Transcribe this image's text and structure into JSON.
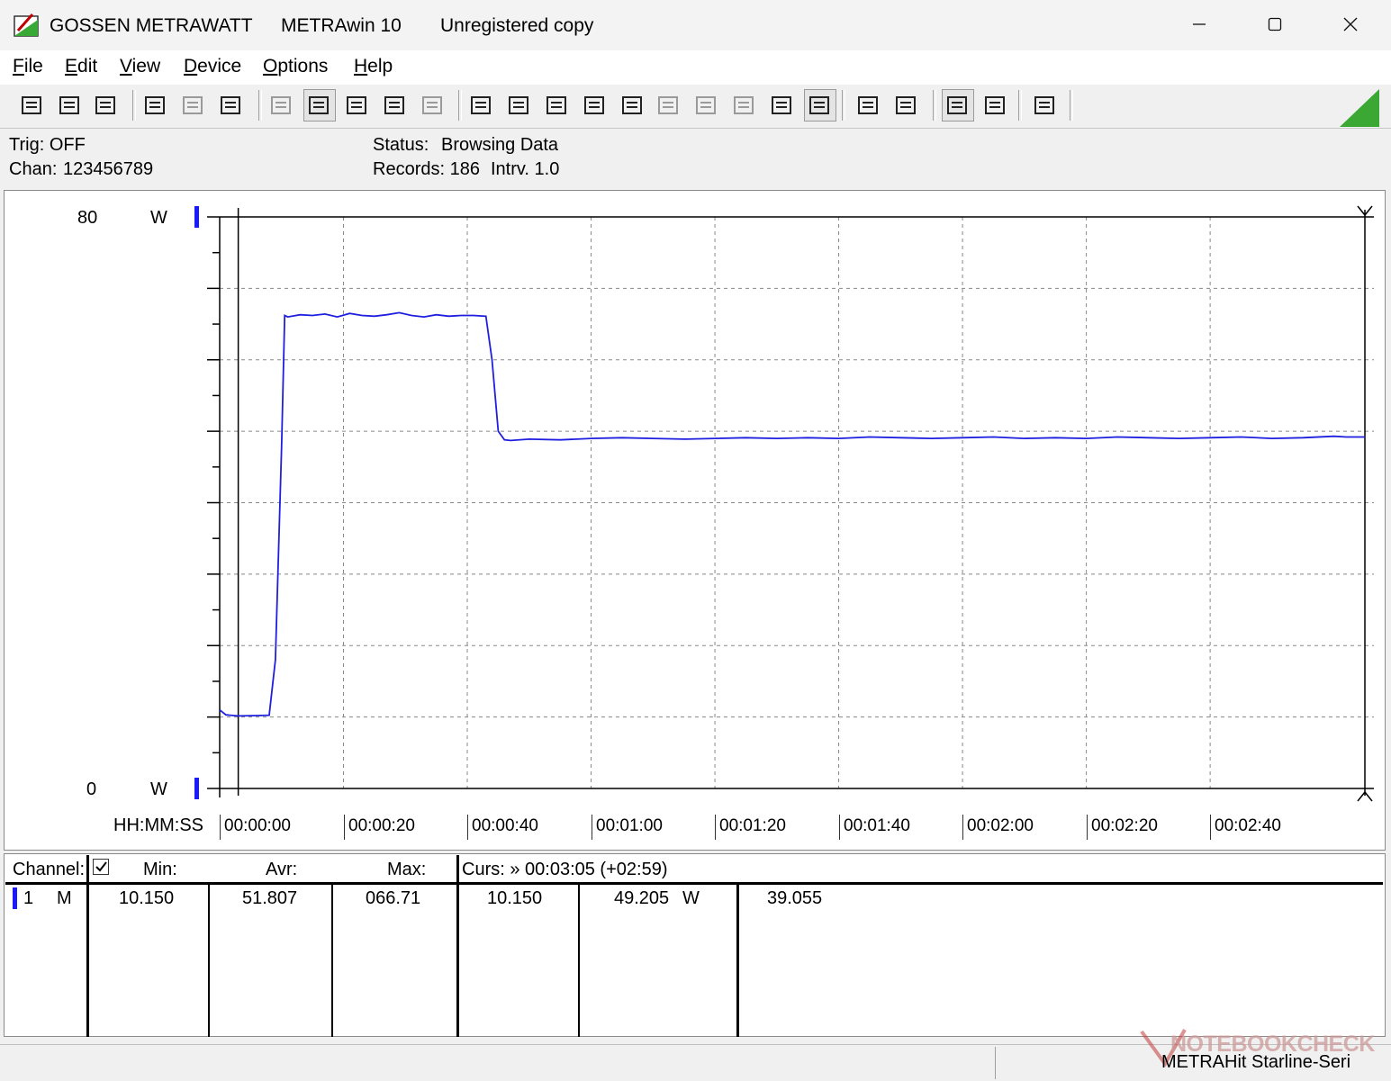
{
  "window": {
    "brand": "GOSSEN METRAWATT",
    "app": "METRAwin 10",
    "registration": "Unregistered copy",
    "minimize_glyph": "—",
    "maximize_glyph": "☐",
    "close_glyph": "✕"
  },
  "menu": [
    {
      "first": "F",
      "rest": "ile"
    },
    {
      "first": "E",
      "rest": "dit"
    },
    {
      "first": "V",
      "rest": "iew"
    },
    {
      "first": "D",
      "rest": "evice"
    },
    {
      "first": "O",
      "rest": "ptions"
    },
    {
      "first": "H",
      "rest": "elp"
    }
  ],
  "toolbar_icons": [
    "save-icon",
    "save-as-icon",
    "open-icon",
    "start-recording-icon",
    "stop-recording-icon",
    "read-memory-icon",
    "numeric-display-icon",
    "line-chart-icon",
    "cursor-crosshair-icon",
    "table-view-icon",
    "bar-chart-icon",
    "align-icon",
    "zoom-fit-icon",
    "list-view-icon",
    "monitor-icon",
    "function-icon",
    "device-icon",
    "waveform-icon",
    "signal-icon",
    "clock-settings-icon",
    "timer-icon",
    "print-icon",
    "print-preview-icon",
    "zoom-icon",
    "zoom-out-icon",
    "comment-icon"
  ],
  "status": {
    "trig": "Trig: OFF",
    "chan_label": "Chan:",
    "chan_value": "123456789",
    "status_label": "Status:",
    "status_value": "Browsing Data",
    "records": "Records: 186",
    "interval": "Intrv. 1.0"
  },
  "chart_data": {
    "type": "line",
    "y_unit": "W",
    "ylim": [
      0,
      80
    ],
    "y_top_label": "80",
    "y_bottom_label": "0",
    "x_axis_label": "HH:MM:SS",
    "xlim_seconds": [
      0,
      185
    ],
    "x_tick_labels": [
      "00:00:00",
      "00:00:20",
      "00:00:40",
      "00:01:00",
      "00:01:20",
      "00:01:40",
      "00:02:00",
      "00:02:20",
      "00:02:40"
    ],
    "x_tick_seconds": [
      0,
      20,
      40,
      60,
      80,
      100,
      120,
      140,
      160
    ],
    "grid": true,
    "line_color": "#1f1fe0",
    "series": [
      {
        "x": [
          0,
          1,
          3,
          6,
          8,
          9,
          10,
          10.5,
          11,
          13,
          15,
          17,
          19,
          21,
          23,
          25,
          27,
          29,
          31,
          33,
          35,
          37,
          39,
          41,
          43,
          44,
          45,
          46,
          47,
          50,
          55,
          60,
          65,
          70,
          75,
          80,
          85,
          90,
          95,
          100,
          105,
          110,
          115,
          120,
          125,
          130,
          135,
          140,
          145,
          150,
          155,
          160,
          165,
          170,
          175,
          180,
          182,
          185
        ],
        "y": [
          11.0,
          10.3,
          10.15,
          10.2,
          10.25,
          18,
          48,
          66.2,
          66.0,
          66.3,
          66.2,
          66.4,
          66.0,
          66.5,
          66.2,
          66.1,
          66.3,
          66.6,
          66.2,
          66.0,
          66.3,
          66.1,
          66.2,
          66.2,
          66.1,
          60,
          50,
          48.8,
          48.7,
          48.9,
          48.8,
          49.0,
          49.1,
          49.0,
          48.9,
          49.0,
          49.1,
          49.0,
          49.1,
          49.0,
          49.2,
          49.1,
          49.0,
          49.1,
          49.2,
          49.0,
          49.1,
          49.0,
          49.2,
          49.1,
          49.0,
          49.1,
          49.2,
          49.0,
          49.1,
          49.3,
          49.2,
          49.2
        ]
      }
    ]
  },
  "table": {
    "headers": {
      "channel": "Channel:",
      "min": "Min:",
      "avr": "Avr:",
      "max": "Max:",
      "cursor": "Curs: » 00:03:05 (+02:59)"
    },
    "row": {
      "channel": "1",
      "mode": "M",
      "min": "10.150",
      "avr": "51.807",
      "max": "066.71",
      "curs_value": "10.150",
      "value2": "49.205",
      "unit": "W",
      "value3": "39.055"
    }
  },
  "footer": {
    "watermark": "NOTEBOOKCHECK",
    "device": "METRAHit Starline-Seri"
  },
  "colors": {
    "channel_marker": "#1a1aff",
    "accent_triangle": "#3aa832"
  }
}
